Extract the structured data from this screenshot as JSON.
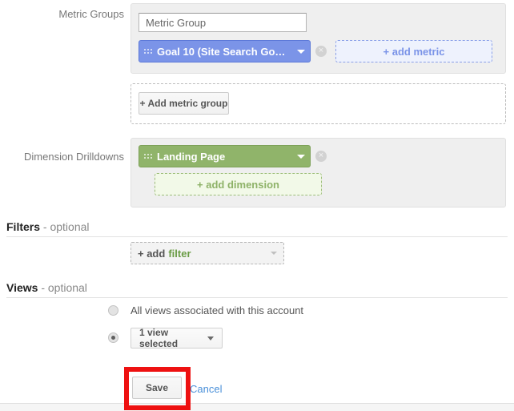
{
  "metric_groups": {
    "label": "Metric Groups",
    "group_name_value": "Metric Group",
    "group_name_placeholder": "Metric Group",
    "metric_chip_label": "Goal 10 (Site Search Go…",
    "metric_remove_icon": "×",
    "add_metric_label": "+ add metric",
    "add_metric_group_label": "+ Add metric group"
  },
  "dimension_drilldowns": {
    "label": "Dimension Drilldowns",
    "dimension_chip_label": "Landing Page",
    "dimension_remove_icon": "×",
    "add_dimension_label": "+ add dimension"
  },
  "filters": {
    "heading_main": "Filters",
    "heading_optional": " - optional",
    "add_filter_lead": "+ add",
    "add_filter_accent": "filter"
  },
  "views": {
    "heading_main": "Views",
    "heading_optional": " - optional",
    "option_all_label": "All views associated with this account",
    "option_selected_value": "1 view selected"
  },
  "actions": {
    "save_label": "Save",
    "cancel_label": "Cancel"
  },
  "colors": {
    "metric_chip": "#7b94e8",
    "dimension_chip": "#90b46a",
    "add_metric_text": "#7b94e8",
    "add_dimension_text": "#8eb268",
    "filter_accent": "#6a9c45",
    "cancel_link": "#4a90d9",
    "annotation": "#ee1111",
    "panel_bg": "#efefef"
  }
}
